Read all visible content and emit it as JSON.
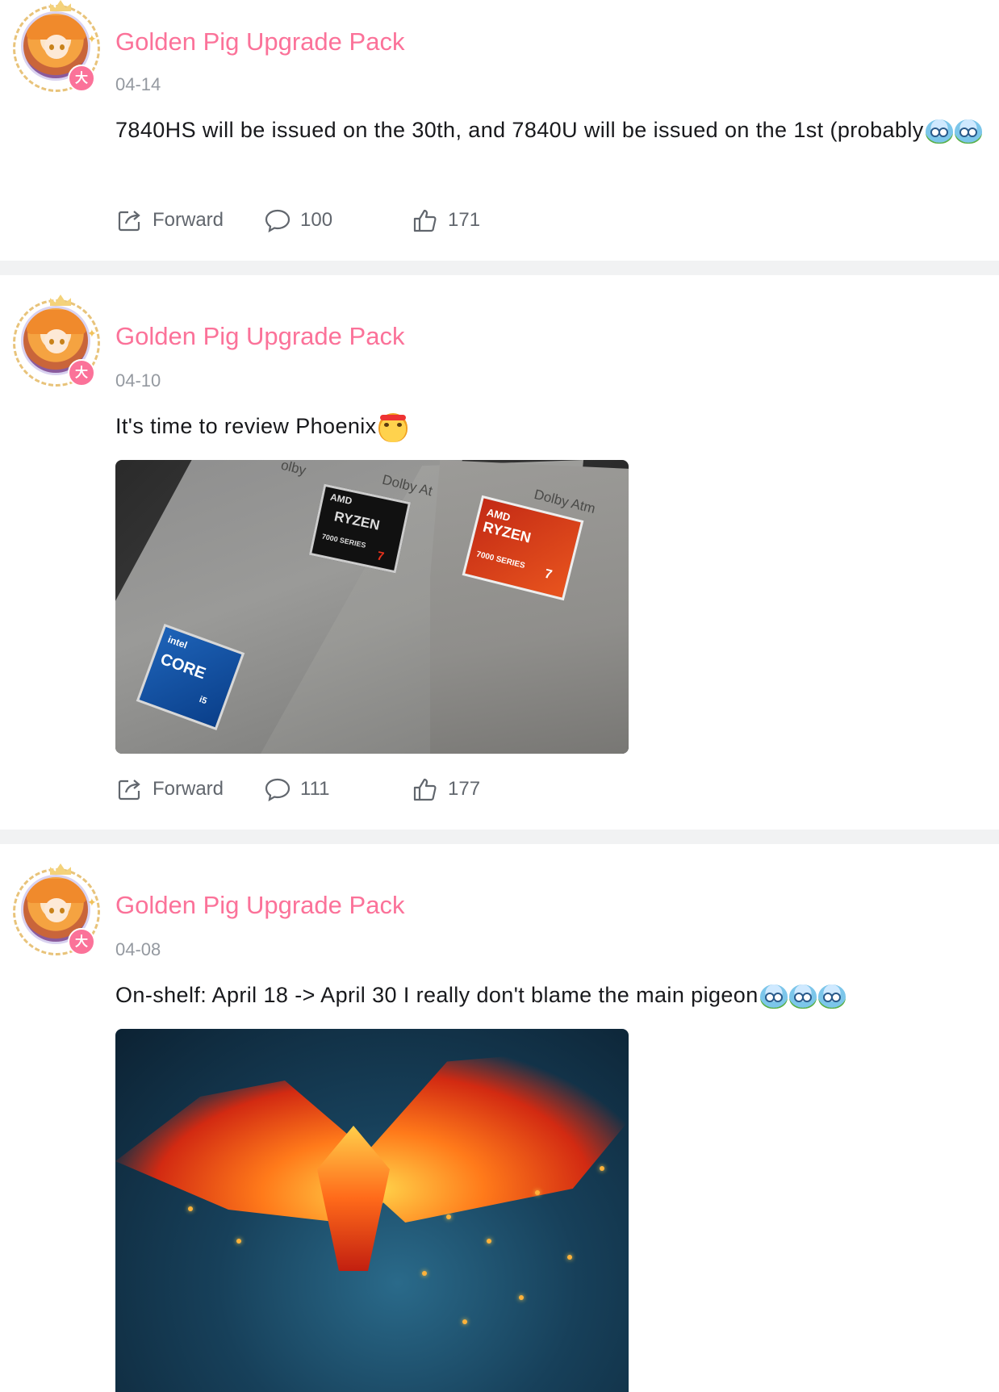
{
  "posts": [
    {
      "author": "Golden Pig Upgrade Pack",
      "avatar_badge": "大",
      "date": "04-14",
      "text": "7840HS will be issued on the 30th, and 7840U will be issued on the 1st (probably",
      "emojis": [
        "crying-bird-emoji",
        "crying-bird-emoji"
      ],
      "forward_label": "Forward",
      "comments": "100",
      "likes": "171"
    },
    {
      "author": "Golden Pig Upgrade Pack",
      "avatar_badge": "大",
      "date": "04-10",
      "text": "It's time to review Phoenix",
      "emojis": [
        "angry-headband-emoji"
      ],
      "image": {
        "description_icon": "laptop-stickers-photo",
        "stickers": {
          "intel": {
            "brand": "intel",
            "product": "CORE",
            "tier": "i5"
          },
          "amd_black": {
            "brand": "AMD",
            "product": "RYZEN",
            "series": "7000 SERIES",
            "tier": "7"
          },
          "amd_red": {
            "brand": "AMD",
            "product": "RYZEN",
            "series": "7000 SERIES",
            "tier": "7"
          }
        },
        "dolby_1": "Dolby At",
        "dolby_2": "Dolby Atm",
        "dolby_3": "olby"
      },
      "forward_label": "Forward",
      "comments": "111",
      "likes": "177"
    },
    {
      "author": "Golden Pig Upgrade Pack",
      "avatar_badge": "大",
      "date": "04-08",
      "text": "On-shelf: April 18 -> April 30 I really don't blame the main pigeon",
      "emojis": [
        "crying-bird-emoji",
        "crying-bird-emoji",
        "crying-bird-emoji"
      ],
      "image": {
        "description_icon": "phoenix-artwork-photo"
      }
    }
  ],
  "colors": {
    "author": "#fb7299",
    "date": "#9499a0",
    "action": "#61666d",
    "separator": "#f1f2f3"
  }
}
